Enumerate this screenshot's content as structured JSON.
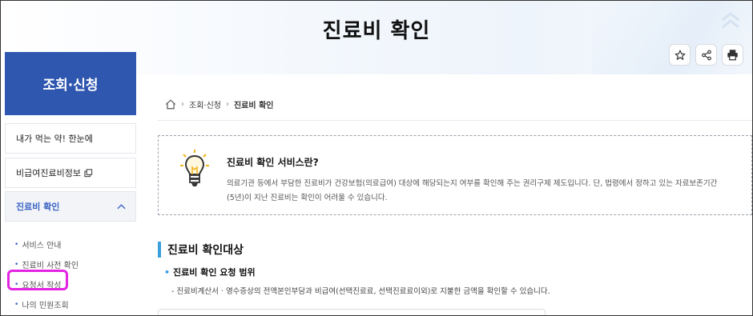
{
  "header": {
    "title": "진료비 확인"
  },
  "toolbar": {
    "favorite_icon": "star-icon",
    "share_icon": "share-icon",
    "print_icon": "print-icon"
  },
  "sidebar": {
    "title": "조회·신청",
    "items": [
      {
        "label": "내가 먹는 약! 한눈에"
      },
      {
        "label": "비급여진료비정보"
      },
      {
        "label": "진료비 확인"
      }
    ],
    "sub_items": [
      {
        "label": "서비스 안내"
      },
      {
        "label": "진료비 사전 확인"
      },
      {
        "label": "요청서 작성"
      },
      {
        "label": "나의 민원조회"
      }
    ]
  },
  "breadcrumb": {
    "level1": "조회·신청",
    "level2": "진료비 확인"
  },
  "notice": {
    "title": "진료비 확인 서비스란?",
    "line1": "의료기관 등에서 부담한 진료비가 건강보험(의료급여) 대상에 해당되는지 여부를 확인해 주는 권리구제 제도입니다. 단, 법령에서 정하고 있는 자료보존기간",
    "line2": "(5년)이 지난 진료비는 확인이 어려울 수 있습니다."
  },
  "main": {
    "section_title": "진료비 확인대상",
    "sub_heading": "진료비 확인 요청 범위",
    "description": "- 진료비계산서 · 영수증상의 전액본인부담과 비급여(선택진료료, 선택진료료이외)로 지불한 금액을 확인할 수 있습니다."
  },
  "colors": {
    "sidebar_head": "#2f57b0",
    "active_text": "#3a63c4",
    "section_bar": "#3aa0dd",
    "highlight": "#e325e3"
  }
}
